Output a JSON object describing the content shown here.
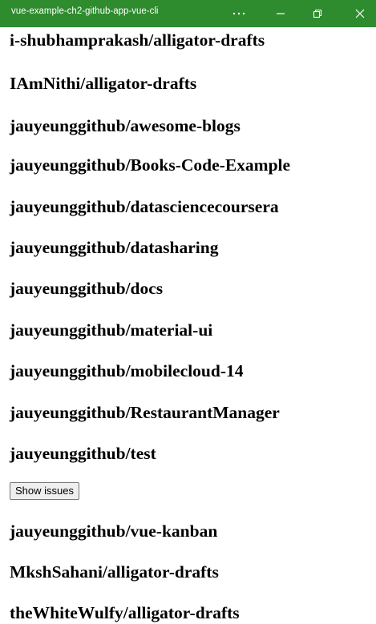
{
  "window": {
    "title": "vue-example-ch2-github-app-vue-cli",
    "more_icon": "more-icon",
    "minimize_icon": "minimize-icon",
    "restore_icon": "restore-icon",
    "close_icon": "close-icon",
    "titlebar_color": "#2e8b2e"
  },
  "repos": [
    "i-shubhamprakash/alligator-drafts",
    "IAmNithi/alligator-drafts",
    "jauyeunggithub/awesome-blogs",
    "jauyeunggithub/Books-Code-Example",
    "jauyeunggithub/datasciencecoursera",
    "jauyeunggithub/datasharing",
    "jauyeunggithub/docs",
    "jauyeunggithub/material-ui",
    "jauyeunggithub/mobilecloud-14",
    "jauyeunggithub/RestaurantManager",
    "jauyeunggithub/test",
    "jauyeunggithub/vue-kanban",
    "MkshSahani/alligator-drafts",
    "theWhiteWulfy/alligator-drafts"
  ],
  "show_issues_label": "Show issues"
}
